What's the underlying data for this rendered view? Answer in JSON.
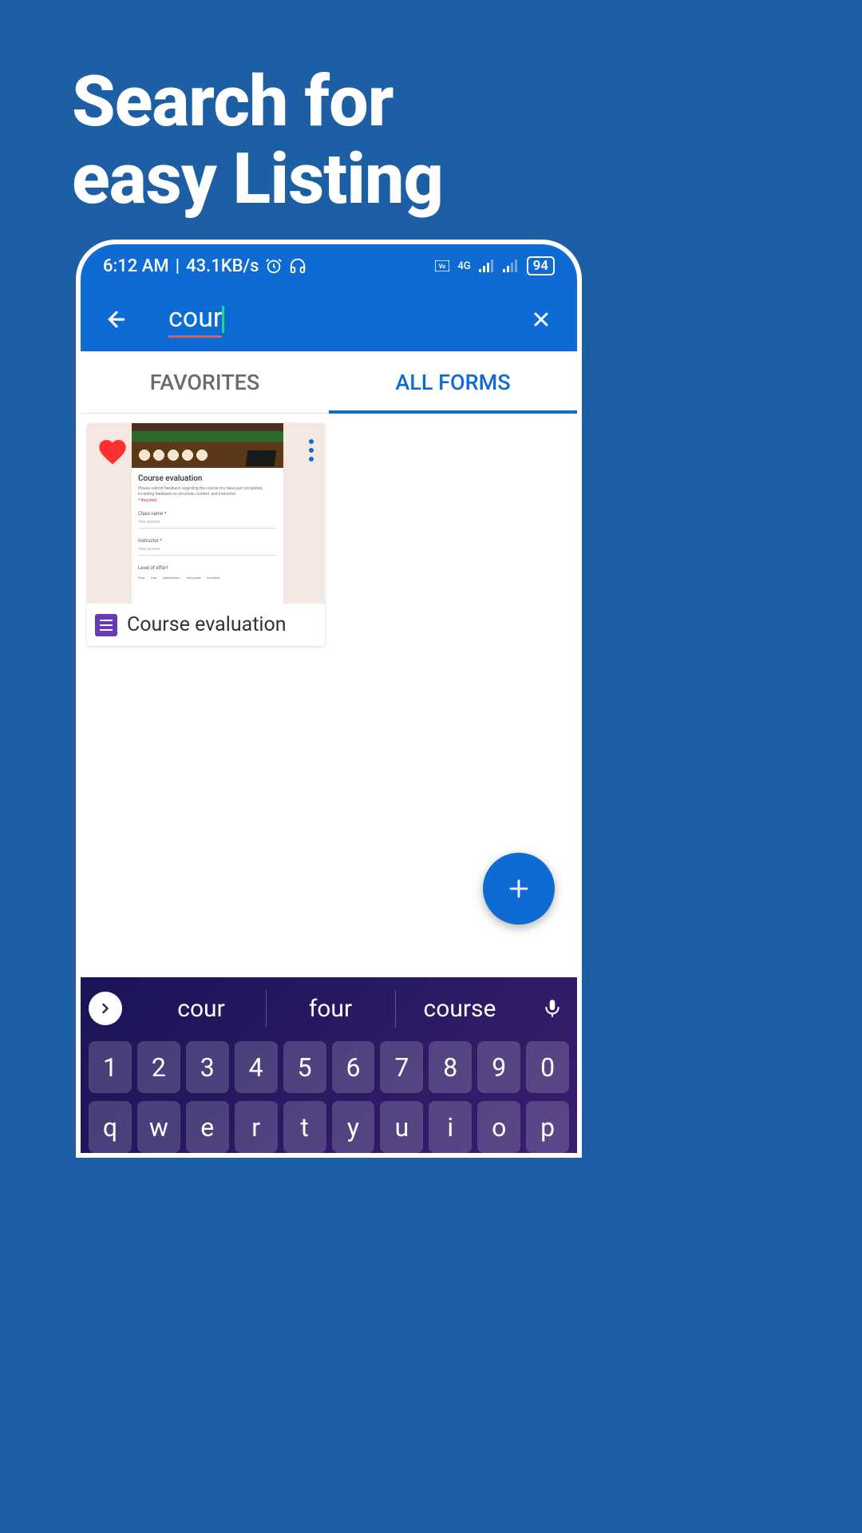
{
  "heading": {
    "line1": "Search for",
    "line2": "easy Listing"
  },
  "status_bar": {
    "time": "6:12 AM",
    "data_rate": "43.1KB/s",
    "network_label": "4G",
    "battery": "94"
  },
  "search": {
    "query": "cour"
  },
  "tabs": {
    "favorites": "FAVORITES",
    "all_forms": "ALL FORMS"
  },
  "form_card": {
    "title": "Course evaluation",
    "thumb": {
      "title": "Course evaluation",
      "field1_label": "Class name *",
      "field2_label": "Instructor *",
      "scale_label": "Level of effort",
      "scale_poor": "Poor",
      "scale_fair": "Fair",
      "scale_satisfactory": "Satisfactory",
      "scale_very_good": "Very good",
      "scale_excellent": "Excellent"
    }
  },
  "fab": {
    "label": "+"
  },
  "keyboard": {
    "suggestions": [
      "cour",
      "four",
      "course"
    ],
    "row1": [
      "1",
      "2",
      "3",
      "4",
      "5",
      "6",
      "7",
      "8",
      "9",
      "0"
    ],
    "row2": [
      "q",
      "w",
      "e",
      "r",
      "t",
      "y",
      "u",
      "i",
      "o",
      "p"
    ]
  }
}
